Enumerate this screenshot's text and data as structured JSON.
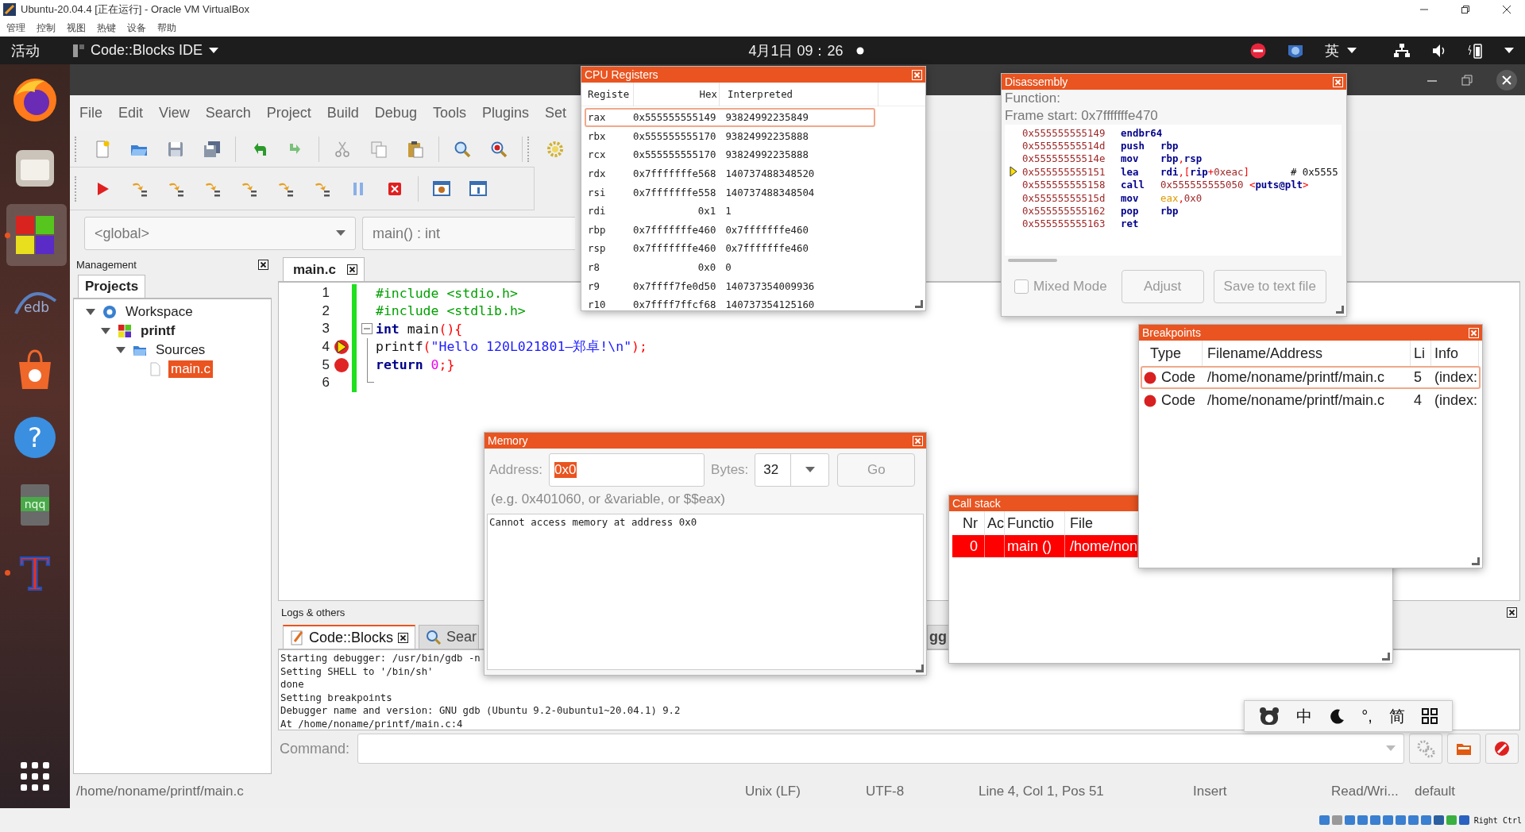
{
  "vbox": {
    "title": "Ubuntu-20.04.4 [正在运行] - Oracle VM VirtualBox",
    "menu": [
      "管理",
      "控制",
      "视图",
      "热键",
      "设备",
      "帮助"
    ],
    "status_label": "Right Ctrl"
  },
  "topbar": {
    "activities": "活动",
    "app": "Code::Blocks IDE",
    "clock": "4月1日 09：26",
    "input_method": "英"
  },
  "dock": [
    {
      "kind": "firefox",
      "selected": false,
      "running": false
    },
    {
      "kind": "files",
      "selected": false,
      "running": false
    },
    {
      "kind": "codeblocks",
      "selected": true,
      "running": true
    },
    {
      "kind": "edb",
      "label": "edb",
      "selected": false,
      "running": false
    },
    {
      "kind": "store",
      "selected": false,
      "running": false
    },
    {
      "kind": "help",
      "label": "?",
      "selected": false,
      "running": false
    },
    {
      "kind": "nqq",
      "label": "nqq",
      "selected": false,
      "running": false
    },
    {
      "kind": "tee",
      "label": "T",
      "selected": false,
      "running": true
    }
  ],
  "menubar": [
    "File",
    "Edit",
    "View",
    "Search",
    "Project",
    "Build",
    "Debug",
    "Tools",
    "Plugins",
    "Set"
  ],
  "scope": {
    "global": "<global>",
    "function": "main() : int"
  },
  "management": {
    "title": "Management",
    "tabs": [
      {
        "label": "Projects",
        "selected": true
      }
    ],
    "tree": [
      {
        "label": "Workspace",
        "kind": "workspace",
        "expanded": true,
        "selected": false,
        "children": [
          {
            "label": "printf",
            "kind": "project",
            "expanded": true,
            "selected": false,
            "children": [
              {
                "label": "Sources",
                "kind": "folder",
                "expanded": true,
                "selected": false,
                "children": [
                  {
                    "label": "main.c",
                    "kind": "file",
                    "selected": true
                  }
                ]
              }
            ]
          }
        ]
      }
    ]
  },
  "editor": {
    "tabs": [
      {
        "label": "main.c",
        "selected": true
      }
    ],
    "lines": [
      {
        "number": "1",
        "breakpoint": false,
        "current": false,
        "changed": true,
        "kind": "plain",
        "tokens": [
          {
            "kind": "preproc",
            "text": "#include <stdio.h>"
          }
        ]
      },
      {
        "number": "2",
        "breakpoint": false,
        "current": false,
        "changed": true,
        "kind": "plain",
        "tokens": [
          {
            "kind": "preproc",
            "text": "#include <stdlib.h>"
          }
        ]
      },
      {
        "number": "3",
        "breakpoint": false,
        "current": false,
        "changed": true,
        "kind": "fold_start",
        "tokens": [
          {
            "kind": "keyword",
            "text": "int"
          },
          {
            "kind": "plain",
            "text": " main"
          },
          {
            "kind": "punct",
            "text": "(){"
          }
        ]
      },
      {
        "number": "4",
        "breakpoint": true,
        "current": true,
        "changed": true,
        "kind": "fold_body",
        "tokens": [
          {
            "kind": "plain",
            "text": "printf"
          },
          {
            "kind": "punct",
            "text": "("
          },
          {
            "kind": "string",
            "text": "\"Hello 120L021801—郑卓!\\n\""
          },
          {
            "kind": "punct",
            "text": ");"
          }
        ]
      },
      {
        "number": "5",
        "breakpoint": true,
        "current": false,
        "changed": true,
        "kind": "fold_body",
        "tokens": [
          {
            "kind": "keyword",
            "text": "return"
          },
          {
            "kind": "number",
            "text": " 0"
          },
          {
            "kind": "punct",
            "text": ";}"
          }
        ]
      },
      {
        "number": "6",
        "breakpoint": false,
        "current": false,
        "changed": true,
        "kind": "fold_end"
      }
    ]
  },
  "logs": {
    "title": "Logs & others",
    "tabs": [
      {
        "label": "Code::Blocks",
        "selected": true
      },
      {
        "label": "Sear",
        "selected": false
      },
      {
        "label": "gg",
        "selected": false
      }
    ],
    "lines": [
      "Starting debugger: /usr/bin/gdb -n",
      "Setting SHELL to '/bin/sh'",
      "done",
      "Setting breakpoints",
      "Debugger name and version: GNU gdb (Ubuntu 9.2-0ubuntu1~20.04.1) 9.2",
      "At /home/noname/printf/main.c:4"
    ],
    "command_label": "Command:"
  },
  "status_bar": [
    "/home/noname/printf/main.c",
    "Unix (LF)",
    "UTF-8",
    "Line 4, Col 1, Pos 51",
    "Insert",
    "Read/Wri...",
    "default"
  ],
  "registers": {
    "title": "CPU Registers",
    "columns": [
      "Registe",
      "Hex",
      "Interpreted"
    ],
    "rows": [
      {
        "name": "rax",
        "hex": "0x555555555149",
        "interpreted": "93824992235849",
        "selected": true
      },
      {
        "name": "rbx",
        "hex": "0x555555555170",
        "interpreted": "93824992235888",
        "selected": false
      },
      {
        "name": "rcx",
        "hex": "0x555555555170",
        "interpreted": "93824992235888",
        "selected": false
      },
      {
        "name": "rdx",
        "hex": "0x7fffffffe568",
        "interpreted": "140737488348520",
        "selected": false
      },
      {
        "name": "rsi",
        "hex": "0x7fffffffe558",
        "interpreted": "140737488348504",
        "selected": false
      },
      {
        "name": "rdi",
        "hex": "0x1",
        "interpreted": "1",
        "selected": false
      },
      {
        "name": "rbp",
        "hex": "0x7fffffffe460",
        "interpreted": "0x7fffffffe460",
        "selected": false
      },
      {
        "name": "rsp",
        "hex": "0x7fffffffe460",
        "interpreted": "0x7fffffffe460",
        "selected": false
      },
      {
        "name": "r8",
        "hex": "0x0",
        "interpreted": "0",
        "selected": false
      },
      {
        "name": "r9",
        "hex": "0x7ffff7fe0d50",
        "interpreted": "140737354009936",
        "selected": false
      },
      {
        "name": "r10",
        "hex": "0x7ffff7ffcf68",
        "interpreted": "140737354125160",
        "selected": false
      }
    ]
  },
  "disassembly": {
    "title": "Disassembly",
    "function_label": "Function:",
    "frame_start": "Frame start: 0x7fffffffe470",
    "lines": [
      {
        "address": "0x555555555149",
        "mnemonic": "endbr64",
        "current": false
      },
      {
        "address": "0x55555555514d",
        "mnemonic": "push",
        "current": false,
        "operands": [
          {
            "kind": "reg",
            "text": "rbp"
          }
        ]
      },
      {
        "address": "0x55555555514e",
        "mnemonic": "mov",
        "current": false,
        "operands": [
          {
            "kind": "reg",
            "text": "rbp"
          },
          {
            "kind": "punct",
            "text": ","
          },
          {
            "kind": "reg",
            "text": "rsp"
          }
        ]
      },
      {
        "address": "0x555555555151",
        "mnemonic": "lea",
        "current": true,
        "operands": [
          {
            "kind": "reg",
            "text": "rdi"
          },
          {
            "kind": "punct",
            "text": ",["
          },
          {
            "kind": "reg",
            "text": "rip"
          },
          {
            "kind": "punct",
            "text": "+"
          },
          {
            "kind": "num",
            "text": "0xeac"
          },
          {
            "kind": "punct",
            "text": "]"
          },
          {
            "kind": "comment",
            "text": "# 0x5555"
          }
        ]
      },
      {
        "address": "0x555555555158",
        "mnemonic": "call",
        "current": false,
        "operands": [
          {
            "kind": "num",
            "text": "0x555555555050 "
          },
          {
            "kind": "punct",
            "text": "<"
          },
          {
            "kind": "reg",
            "text": "puts@plt"
          },
          {
            "kind": "punct",
            "text": ">"
          }
        ]
      },
      {
        "address": "0x55555555515d",
        "mnemonic": "mov",
        "current": false,
        "operands": [
          {
            "kind": "sym",
            "text": "eax"
          },
          {
            "kind": "punct",
            "text": ","
          },
          {
            "kind": "num",
            "text": "0x0"
          }
        ]
      },
      {
        "address": "0x555555555162",
        "mnemonic": "pop",
        "current": false,
        "operands": [
          {
            "kind": "reg",
            "text": "rbp"
          }
        ]
      },
      {
        "address": "0x555555555163",
        "mnemonic": "ret",
        "current": false
      }
    ],
    "mixed_mode": {
      "label": "Mixed Mode",
      "checked": false,
      "disabled": true
    },
    "buttons": [
      {
        "label": "Adjust",
        "disabled": true
      },
      {
        "label": "Save to text file",
        "disabled": true
      }
    ]
  },
  "memory": {
    "title": "Memory",
    "address_label": "Address:",
    "address": "0x0",
    "bytes_label": "Bytes:",
    "bytes": "32",
    "go": "Go",
    "hint": "(e.g. 0x401060, or &variable, or $$eax)",
    "output": "Cannot access memory at address 0x0"
  },
  "call_stack": {
    "title": "Call stack",
    "columns": [
      "Nr",
      "Ac",
      "Functio",
      "File"
    ],
    "rows": [
      {
        "nr": "0",
        "function": "main ()",
        "file": "/home/non",
        "selected": true
      }
    ]
  },
  "breakpoints": {
    "title": "Breakpoints",
    "columns": [
      "Type",
      "Filename/Address",
      "Li",
      "Info"
    ],
    "rows": [
      {
        "type": "Code",
        "file": "/home/noname/printf/main.c",
        "line": "5",
        "info": "(index:",
        "selected": true
      },
      {
        "type": "Code",
        "file": "/home/noname/printf/main.c",
        "line": "4",
        "info": "(index:",
        "selected": false
      }
    ]
  },
  "ime": [
    {
      "kind": "logo"
    },
    {
      "kind": "text",
      "text": "中"
    },
    {
      "kind": "moon"
    },
    {
      "kind": "text",
      "text": "°,"
    },
    {
      "kind": "text",
      "text": "简"
    },
    {
      "kind": "grid"
    }
  ]
}
